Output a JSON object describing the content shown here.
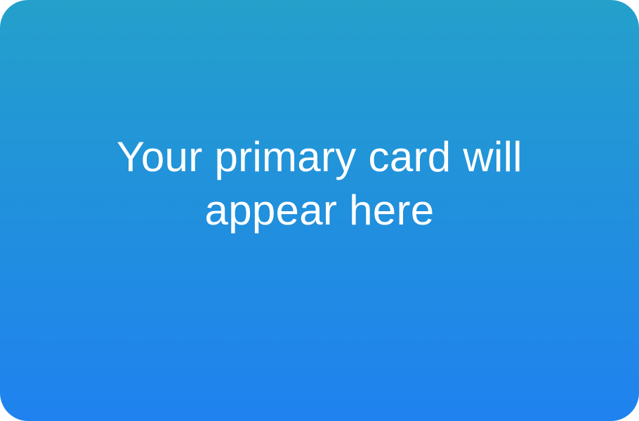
{
  "card": {
    "placeholder_text": "Your primary card will appear here",
    "gradient_top_color": "#24a0cb",
    "gradient_bottom_color": "#1f82ef",
    "text_color": "#ffffff"
  }
}
